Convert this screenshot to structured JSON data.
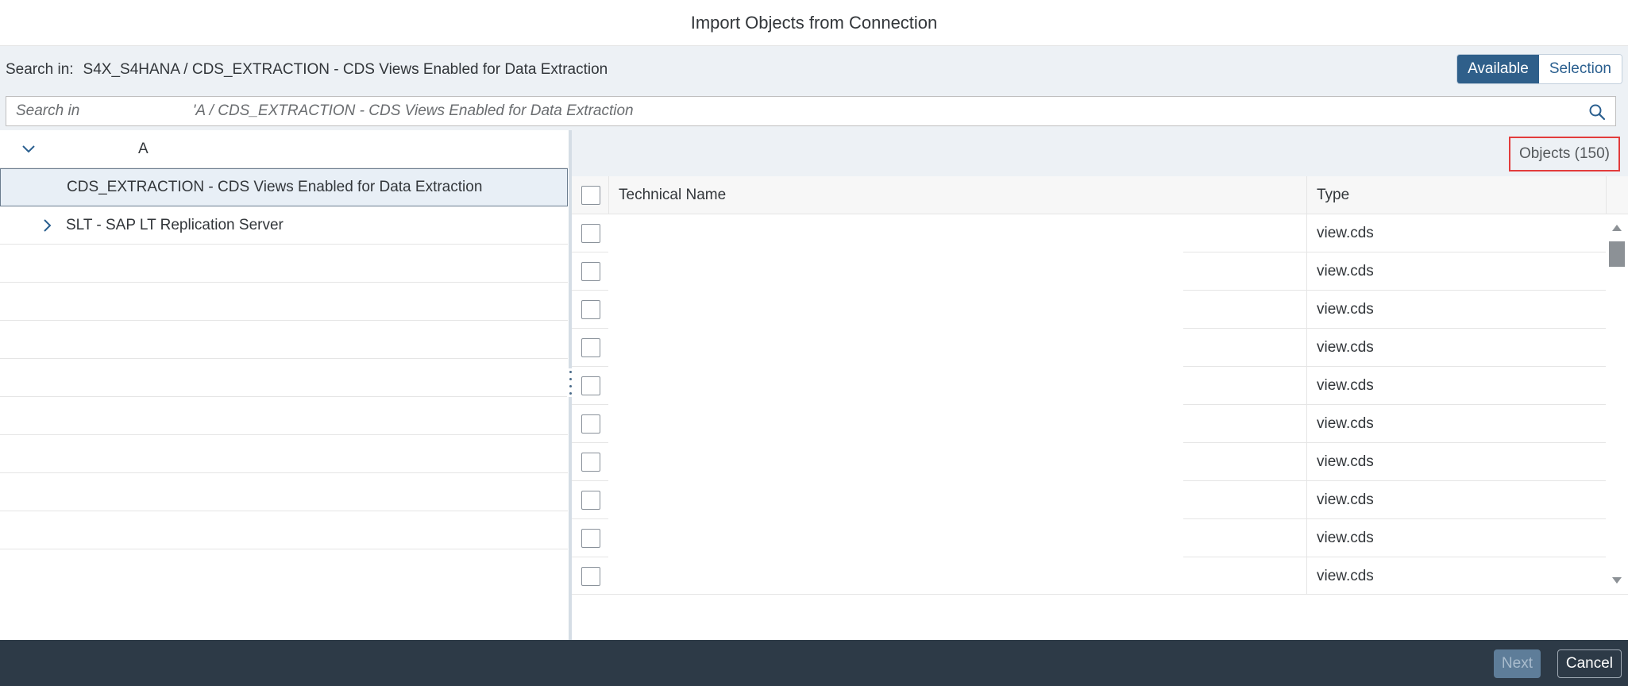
{
  "dialog": {
    "title": "Import Objects from Connection"
  },
  "search_in": {
    "label": "Search in:",
    "path": "S4X_S4HANA / CDS_EXTRACTION - CDS Views Enabled for Data Extraction"
  },
  "view_toggle": {
    "available": "Available",
    "selection": "Selection",
    "active": "Available"
  },
  "search": {
    "placeholder": "Search in                           'A / CDS_EXTRACTION - CDS Views Enabled for Data Extraction"
  },
  "tree": {
    "root_label": "A",
    "items": [
      {
        "label": "CDS_EXTRACTION - CDS Views Enabled for Data Extraction",
        "selected": true
      },
      {
        "label": "SLT - SAP LT Replication Server",
        "selected": false
      }
    ]
  },
  "objects": {
    "count_label": "Objects (150)",
    "columns": {
      "technical_name": "Technical Name",
      "type": "Type"
    },
    "rows": [
      {
        "name": "",
        "type": "view.cds"
      },
      {
        "name": "",
        "type": "view.cds"
      },
      {
        "name": "",
        "type": "view.cds"
      },
      {
        "name": "",
        "type": "view.cds"
      },
      {
        "name": "",
        "type": "view.cds"
      },
      {
        "name": "",
        "type": "view.cds"
      },
      {
        "name": "",
        "type": "view.cds"
      },
      {
        "name": "",
        "type": "view.cds"
      },
      {
        "name": "",
        "type": "view.cds"
      },
      {
        "name": "",
        "type": "view.cds"
      }
    ]
  },
  "footer": {
    "next": "Next",
    "cancel": "Cancel"
  },
  "colors": {
    "accent": "#2f5f8a",
    "highlight_box": "#e23c3c",
    "footer_bg": "#2d3a47"
  }
}
